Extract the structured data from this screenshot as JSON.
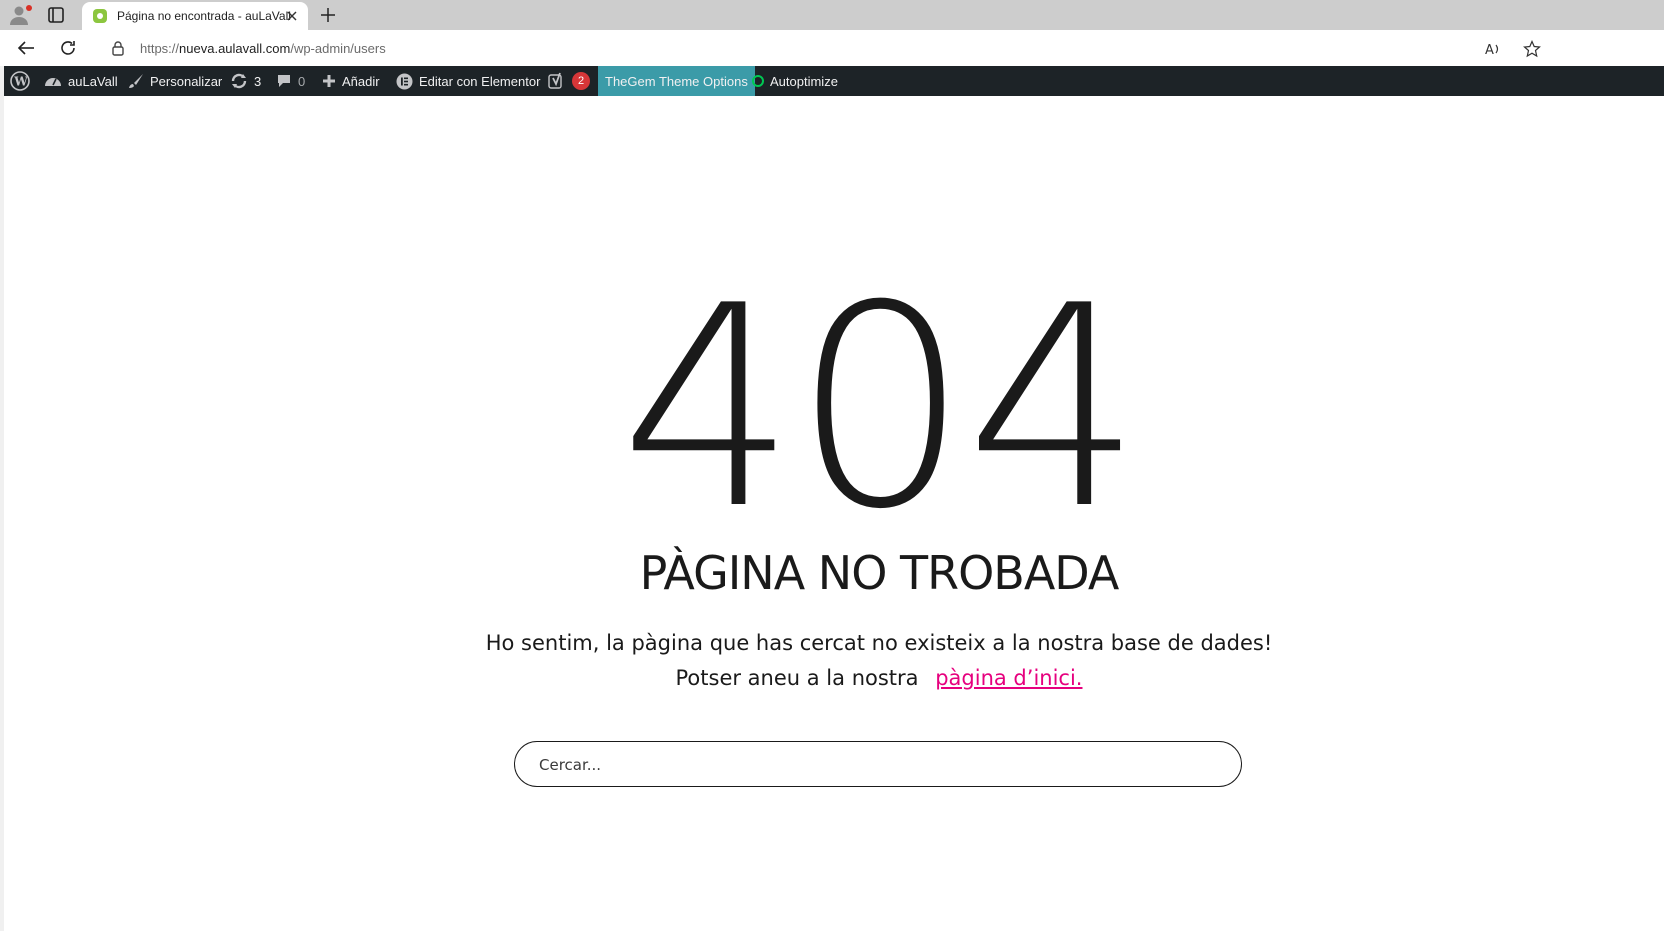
{
  "browser": {
    "tab_title": "Página no encontrada - auLaVall",
    "url_scheme": "https://",
    "url_host": "nueva.aulavall.com",
    "url_path": "/wp-admin/users"
  },
  "adminbar": {
    "site_name": "auLaVall",
    "customize": "Personalizar",
    "updates_count": "3",
    "comments_count": "0",
    "new": "Añadir",
    "elementor": "Editar con Elementor",
    "yoast_badge": "2",
    "thegem": "TheGem Theme Options",
    "autoptimize": "Autoptimize",
    "colors": {
      "bar": "#1d2327",
      "thegem": "#3b9ba8",
      "badge": "#d63638"
    }
  },
  "page": {
    "code": "404",
    "heading": "PÀGINA NO TROBADA",
    "message_line1": "Ho sentim, la pàgina que has cercat no existeix a la nostra base de dades!",
    "message_line2": "Potser aneu a la nostra",
    "home_link": "pàgina d’inici.",
    "search_placeholder": "Cercar...",
    "colors": {
      "link": "#e6007e",
      "text": "#1a1a1a"
    }
  }
}
